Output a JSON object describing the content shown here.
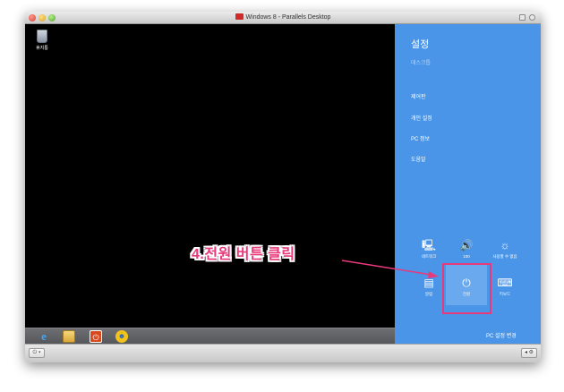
{
  "window": {
    "title": "Windows 8 - Parallels Desktop"
  },
  "desktop": {
    "recycle_bin_label": "휴지통",
    "taskbar_icons": [
      "ie-icon",
      "file-explorer-icon",
      "office-icon",
      "messenger-icon"
    ]
  },
  "charms": {
    "title": "설정",
    "subtitle": "데스크톱",
    "items": [
      {
        "label": "제어판"
      },
      {
        "label": "개인 설정"
      },
      {
        "label": "PC 정보"
      },
      {
        "label": "도움말"
      }
    ],
    "quick_settings": [
      {
        "label": "네트워크",
        "icon": "network-icon",
        "glyph": "🖳"
      },
      {
        "label": "100",
        "icon": "volume-icon",
        "glyph": "🔊"
      },
      {
        "label": "사용할 수 없음",
        "icon": "brightness-icon",
        "glyph": "☼"
      },
      {
        "label": "알림",
        "icon": "notifications-icon",
        "glyph": "▤"
      },
      {
        "label": "전원",
        "icon": "power-icon",
        "glyph": "⏻"
      },
      {
        "label": "키보드",
        "icon": "keyboard-icon",
        "glyph": "⌨"
      }
    ],
    "pc_settings_label": "PC 설정 변경"
  },
  "annotation": {
    "text": "4.전원 버튼 클릭",
    "color": "#e8397a"
  },
  "statusbar": {
    "left_button": "⏻ ▾",
    "right_button": "◂ ⚙"
  }
}
